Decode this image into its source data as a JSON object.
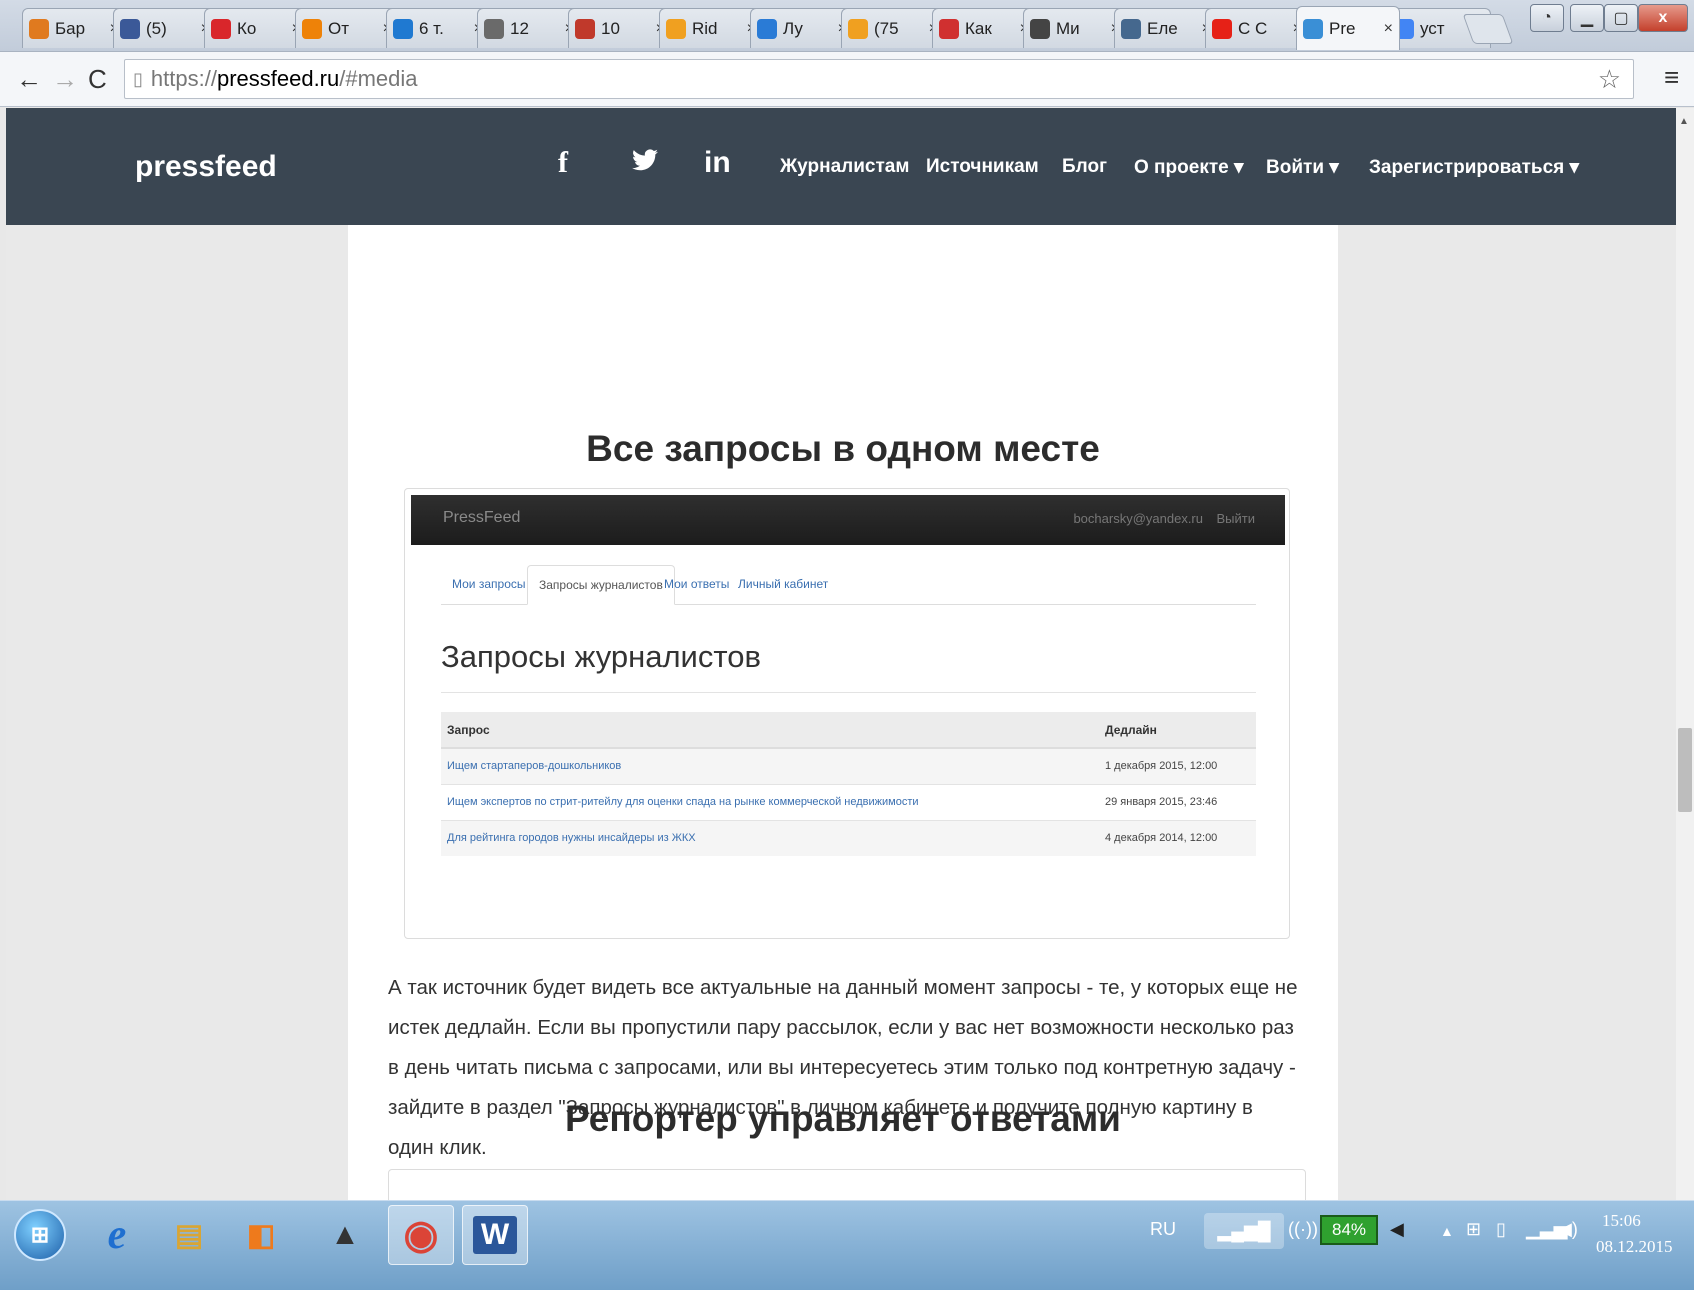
{
  "browser": {
    "tabs": [
      {
        "label": "Бар",
        "icon": "bear-icon",
        "color": "#e07a1f"
      },
      {
        "label": "(5)",
        "icon": "facebook-icon",
        "color": "#3b5998"
      },
      {
        "label": "Ко",
        "icon": "red-circle-icon",
        "color": "#d9262b"
      },
      {
        "label": "От",
        "icon": "ok-icon",
        "color": "#ee8208"
      },
      {
        "label": "6 т.",
        "icon": "blue-circle-icon",
        "color": "#1f79d1"
      },
      {
        "label": "12",
        "icon": "thumbs-up-icon",
        "color": "#6a6a6a"
      },
      {
        "label": "10",
        "icon": "rk-icon",
        "color": "#c0392b"
      },
      {
        "label": "Rid",
        "icon": "r-icon",
        "color": "#f0a020"
      },
      {
        "label": "Лу",
        "icon": "diamond-icon",
        "color": "#2a7bd6"
      },
      {
        "label": "(75",
        "icon": "at-icon",
        "color": "#f0a020"
      },
      {
        "label": "Как",
        "icon": "m-icon",
        "color": "#d03030"
      },
      {
        "label": "Ми",
        "icon": "globe-icon",
        "color": "#444444"
      },
      {
        "label": "Еле",
        "icon": "vk-icon",
        "color": "#45688e"
      },
      {
        "label": "С С",
        "icon": "youtube-icon",
        "color": "#e62117"
      },
      {
        "label": "Pre",
        "icon": "pressfeed-icon",
        "color": "#3a8fd6"
      },
      {
        "label": "уст",
        "icon": "google-icon",
        "color": "#4285f4"
      }
    ],
    "active_tab": 14,
    "close_glyph": "×",
    "url_scheme": "https://",
    "url_host": "pressfeed.ru",
    "url_path": "/#media"
  },
  "site": {
    "logo": "pressfeed",
    "social": [
      "f",
      "t",
      "in"
    ],
    "nav": {
      "journalists": "Журналистам",
      "sources": "Источникам",
      "blog": "Блог",
      "about": "О проекте ▾",
      "login": "Войти ▾",
      "register": "Зарегистрироваться ▾"
    }
  },
  "content": {
    "heading1": "Все запросы в одном месте",
    "screenshot": {
      "brand": "PressFeed",
      "email": "bocharsky@yandex.ru",
      "logout": "Выйти",
      "tabs": [
        "Мои запросы",
        "Запросы журналистов",
        "Мои ответы",
        "Личный кабинет"
      ],
      "active_tab": 1,
      "title": "Запросы журналистов",
      "table": {
        "headers": [
          "Запрос",
          "Дедлайн"
        ],
        "rows": [
          [
            "Ищем стартаперов-дошкольников",
            "1 декабря 2015, 12:00"
          ],
          [
            "Ищем экспертов по стрит-ритейлу для оценки спада на рынке коммерческой недвижимости",
            "29 января 2015, 23:46"
          ],
          [
            "Для рейтинга городов нужны инсайдеры из ЖКХ",
            "4 декабря 2014, 12:00"
          ]
        ]
      }
    },
    "paragraph": "А так источник будет видеть все актуальные на данный момент запросы - те, у которых еще не истек дедлайн. Если вы пропустили пару рассылок, если у вас нет возможности несколько раз в день читать письма с запросами, или вы интересуетесь этим только под контретную задачу - зайдите в раздел \"Запросы журналистов\" в личном кабинете и получите полную картину в один клик.",
    "heading2": "Репортер управляет ответами"
  },
  "taskbar": {
    "apps": [
      {
        "name": "ie-icon",
        "glyph": "e",
        "color": "#1f6fd0"
      },
      {
        "name": "explorer-icon",
        "glyph": "▤",
        "color": "#d9a534"
      },
      {
        "name": "media-player-icon",
        "glyph": "◧",
        "color": "#ee7a1c"
      },
      {
        "name": "stamp-icon",
        "glyph": "▲",
        "color": "#333333"
      },
      {
        "name": "chrome-icon",
        "glyph": "◉",
        "color": "#db4437"
      },
      {
        "name": "word-icon",
        "glyph": "W",
        "color": "#2b579a"
      }
    ],
    "language": "RU",
    "battery": "84%",
    "time": "15:06",
    "date": "08.12.2015"
  }
}
